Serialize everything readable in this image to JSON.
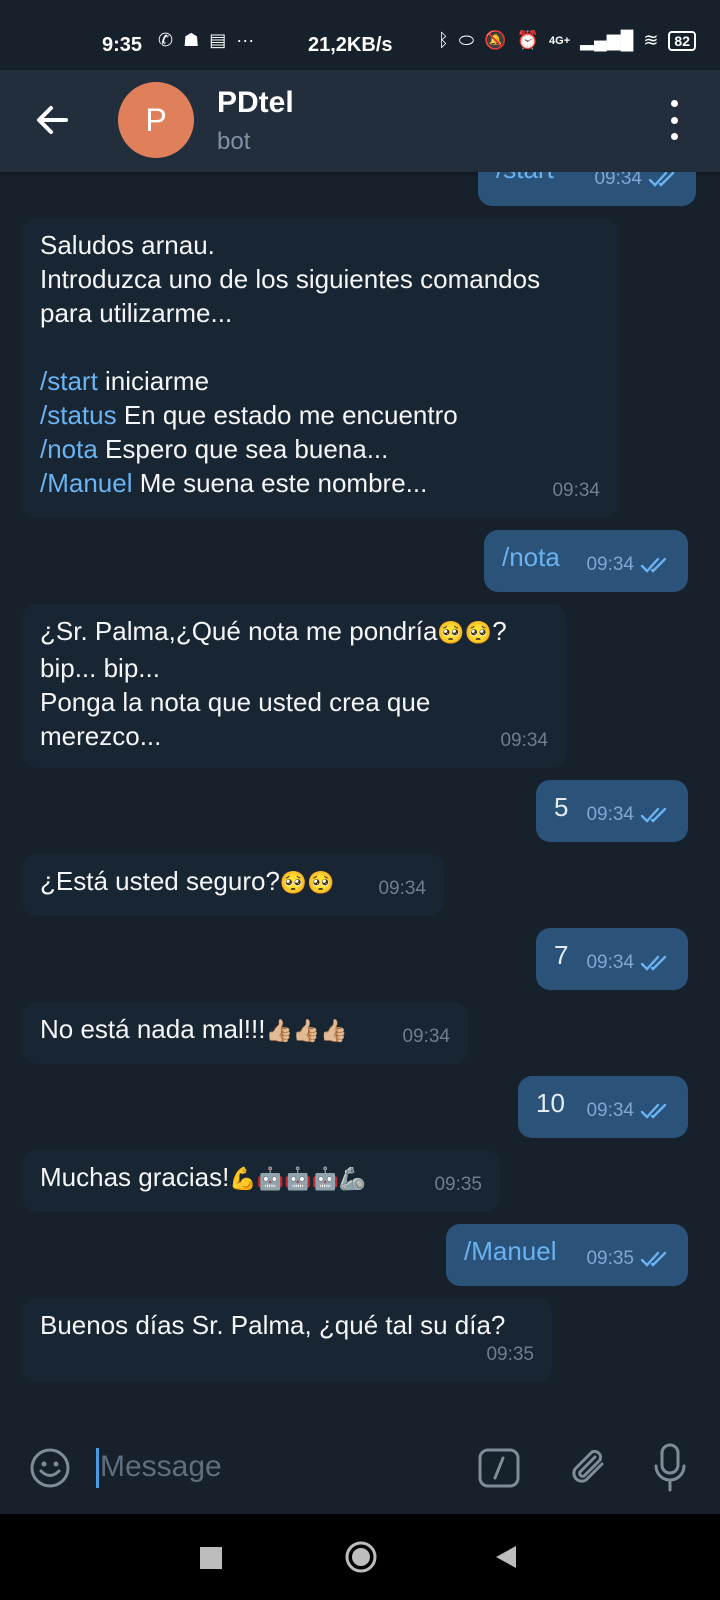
{
  "status_bar": {
    "time": "9:35",
    "speed": "21,2KB/s",
    "network": "4G+",
    "battery": "82"
  },
  "header": {
    "avatar_letter": "P",
    "title": "PDtel",
    "subtitle": "bot"
  },
  "messages": [
    {
      "dir": "out",
      "lines": [
        [
          {
            "t": "/start",
            "c": true
          }
        ]
      ],
      "time": "09:34",
      "read": true
    },
    {
      "dir": "in",
      "lines": [
        [
          {
            "t": "Saludos arnau."
          }
        ],
        [
          {
            "t": "Introduzca uno de los siguientes comandos"
          }
        ],
        [
          {
            "t": "para utilizarme..."
          }
        ],
        [
          {
            "t": " "
          }
        ],
        [
          {
            "t": "/start",
            "c": true
          },
          {
            "t": " iniciarme"
          }
        ],
        [
          {
            "t": "/status",
            "c": true
          },
          {
            "t": " En que estado me encuentro"
          }
        ],
        [
          {
            "t": "/nota",
            "c": true
          },
          {
            "t": " Espero que sea buena..."
          }
        ],
        [
          {
            "t": "/Manuel",
            "c": true
          },
          {
            "t": " Me suena este nombre..."
          }
        ]
      ],
      "time": "09:34"
    },
    {
      "dir": "out",
      "lines": [
        [
          {
            "t": "/nota",
            "c": true
          }
        ]
      ],
      "time": "09:34",
      "read": true
    },
    {
      "dir": "in",
      "lines": [
        [
          {
            "t": "¿Sr. Palma,¿Qué nota me pondría"
          },
          {
            "t": "🥺🥺",
            "e": true
          },
          {
            "t": "?"
          }
        ],
        [
          {
            "t": "bip... bip..."
          }
        ],
        [
          {
            "t": "Ponga la nota que usted crea que"
          }
        ],
        [
          {
            "t": "merezco..."
          }
        ]
      ],
      "time": "09:34"
    },
    {
      "dir": "out",
      "lines": [
        [
          {
            "t": "5"
          }
        ]
      ],
      "time": "09:34",
      "read": true
    },
    {
      "dir": "in",
      "lines": [
        [
          {
            "t": "¿Está usted seguro?"
          },
          {
            "t": "🥺🥺",
            "e": true
          }
        ]
      ],
      "time": "09:34"
    },
    {
      "dir": "out",
      "lines": [
        [
          {
            "t": "7"
          }
        ]
      ],
      "time": "09:34",
      "read": true
    },
    {
      "dir": "in",
      "lines": [
        [
          {
            "t": "No está nada mal!!!"
          },
          {
            "t": "👍🏼👍🏼👍🏼",
            "e": true
          }
        ]
      ],
      "time": "09:34"
    },
    {
      "dir": "out",
      "lines": [
        [
          {
            "t": "10"
          }
        ]
      ],
      "time": "09:34",
      "read": true
    },
    {
      "dir": "in",
      "lines": [
        [
          {
            "t": "Muchas gracias!"
          },
          {
            "t": "💪🤖🤖🤖🦾",
            "e": true
          }
        ]
      ],
      "time": "09:35"
    },
    {
      "dir": "out",
      "lines": [
        [
          {
            "t": "/Manuel",
            "c": true
          }
        ]
      ],
      "time": "09:35",
      "read": true
    },
    {
      "dir": "in",
      "lines": [
        [
          {
            "t": "Buenos días Sr. Palma, ¿qué tal su día?"
          }
        ]
      ],
      "time": "09:35"
    }
  ],
  "input": {
    "placeholder": "Message"
  },
  "colors": {
    "background": "#17212b",
    "header": "#232e3c",
    "incoming_bubble": "#182533",
    "outgoing_bubble": "#2b5278",
    "command": "#6ab3f3",
    "avatar": "#e0805a"
  },
  "icons": {
    "back": "arrow-left-icon",
    "menu": "more-vertical-icon",
    "emoji": "smile-icon",
    "commands": "slash-command-icon",
    "attach": "paperclip-icon",
    "voice": "microphone-icon"
  }
}
